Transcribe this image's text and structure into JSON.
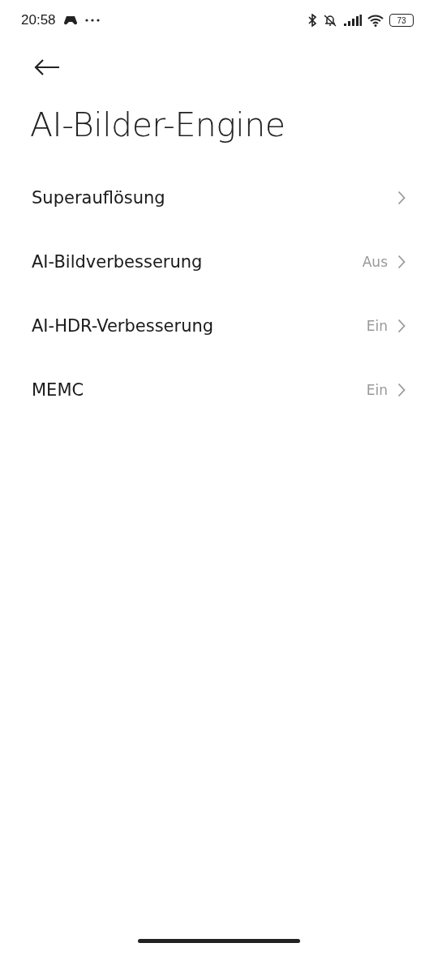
{
  "status_bar": {
    "time": "20:58",
    "battery": "73"
  },
  "title": "AI-Bilder-Engine",
  "items": [
    {
      "label": "Superauflösung"
    },
    {
      "label": "AI-Bildverbesserung",
      "value": "Aus"
    },
    {
      "label": "AI-HDR-Verbesserung",
      "value": "Ein"
    },
    {
      "label": "MEMC",
      "value": "Ein"
    }
  ]
}
